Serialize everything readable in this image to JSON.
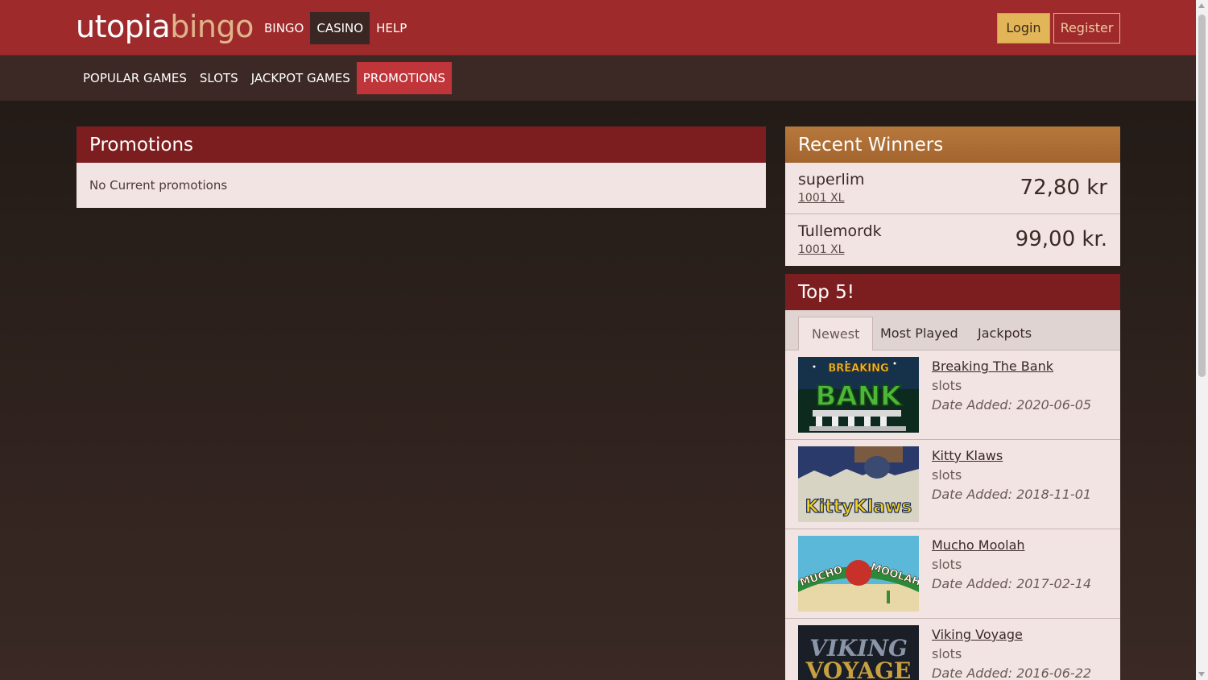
{
  "brand": {
    "part1": "utopia",
    "part2": "bingo"
  },
  "main_nav": [
    {
      "label": "BINGO",
      "active": false
    },
    {
      "label": "CASINO",
      "active": true
    },
    {
      "label": "HELP",
      "active": false
    }
  ],
  "auth": {
    "login": "Login",
    "register": "Register"
  },
  "sub_nav": [
    {
      "label": "POPULAR GAMES",
      "active": false
    },
    {
      "label": "SLOTS",
      "active": false
    },
    {
      "label": "JACKPOT GAMES",
      "active": false
    },
    {
      "label": "PROMOTIONS",
      "active": true
    }
  ],
  "promotions": {
    "title": "Promotions",
    "empty_text": "No Current promotions"
  },
  "recent_winners": {
    "title": "Recent Winners",
    "items": [
      {
        "name": "superlim",
        "game": "1001 XL",
        "amount": "72,80 kr"
      },
      {
        "name": "Tullemordk",
        "game": "1001 XL",
        "amount": "99,00 kr."
      }
    ]
  },
  "top5": {
    "title": "Top 5!",
    "tabs": [
      {
        "label": "Newest",
        "active": true
      },
      {
        "label": "Most Played",
        "active": false
      },
      {
        "label": "Jackpots",
        "active": false
      }
    ],
    "games": [
      {
        "title": "Breaking The Bank",
        "category": "slots",
        "date": "Date Added: 2020-06-05",
        "thumb_text": "BREAKING the BANK"
      },
      {
        "title": "Kitty Klaws",
        "category": "slots",
        "date": "Date Added: 2018-11-01",
        "thumb_text": "KittyKlaws"
      },
      {
        "title": "Mucho Moolah",
        "category": "slots",
        "date": "Date Added: 2017-02-14",
        "thumb_text": "MUCHO MOOLAH"
      },
      {
        "title": "Viking Voyage",
        "category": "slots",
        "date": "Date Added: 2016-06-22",
        "thumb_text": "VIKING VOYAGE"
      }
    ]
  },
  "colors": {
    "header_red": "#9e2a2b",
    "subnav_brown": "#3c2925",
    "active_promo_tab": "#c0353a",
    "winners_gold": "#b6783c",
    "panel_red": "#7c1e1f",
    "login_gold": "#e2b558"
  }
}
